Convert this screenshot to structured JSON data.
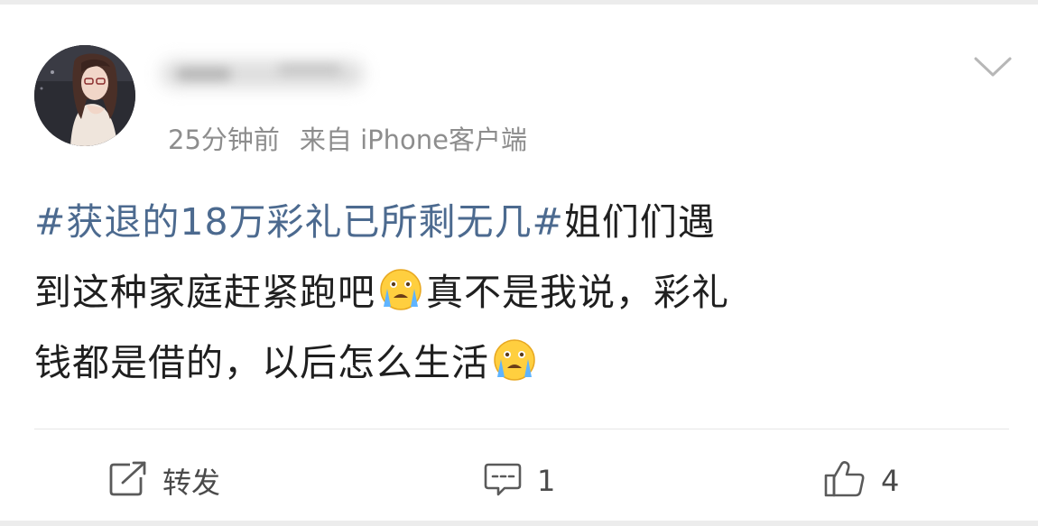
{
  "post": {
    "time": "25分钟前",
    "source": "来自 iPhone客户端",
    "lines": [
      {
        "hashtag": "#获退的18万彩礼已所剩无几#",
        "text": "姐们们遇"
      },
      {
        "text_a": "到这种家庭赶紧跑吧",
        "emoji": "crying-face-icon",
        "text_b": "真不是我说，彩礼"
      },
      {
        "text_a": "钱都是借的，以后怎么生活",
        "emoji": "crying-face-icon"
      }
    ]
  },
  "actions": {
    "repost_label": "转发",
    "comment_count": "1",
    "like_count": "4"
  },
  "colors": {
    "hashtag": "#4c6a8f",
    "meta_text": "#8d8d8d",
    "body_text": "#1f1f1f",
    "background": "#ffffff"
  }
}
